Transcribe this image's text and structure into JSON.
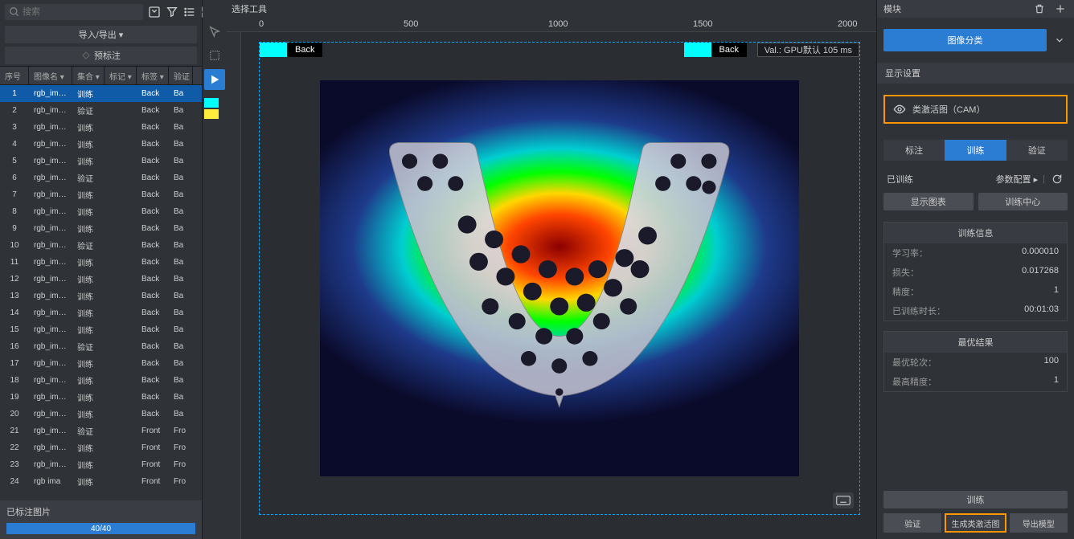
{
  "search": {
    "placeholder": "搜索"
  },
  "import_export": "导入/导出 ▾",
  "pre_annotate": "预标注",
  "table": {
    "headers": {
      "idx": "序号",
      "name": "图像名 ▾",
      "set": "集合 ▾",
      "mark": "标记 ▾",
      "tag": "标签 ▾",
      "val": "验证"
    },
    "rows": [
      {
        "idx": "1",
        "name": "rgb_ima...",
        "set": "训练",
        "tag": "Back",
        "val": "Ba"
      },
      {
        "idx": "2",
        "name": "rgb_ima...",
        "set": "验证",
        "tag": "Back",
        "val": "Ba"
      },
      {
        "idx": "3",
        "name": "rgb_ima...",
        "set": "训练",
        "tag": "Back",
        "val": "Ba"
      },
      {
        "idx": "4",
        "name": "rgb_ima...",
        "set": "训练",
        "tag": "Back",
        "val": "Ba"
      },
      {
        "idx": "5",
        "name": "rgb_ima...",
        "set": "训练",
        "tag": "Back",
        "val": "Ba"
      },
      {
        "idx": "6",
        "name": "rgb_ima...",
        "set": "验证",
        "tag": "Back",
        "val": "Ba"
      },
      {
        "idx": "7",
        "name": "rgb_ima...",
        "set": "训练",
        "tag": "Back",
        "val": "Ba"
      },
      {
        "idx": "8",
        "name": "rgb_ima...",
        "set": "训练",
        "tag": "Back",
        "val": "Ba"
      },
      {
        "idx": "9",
        "name": "rgb_ima...",
        "set": "训练",
        "tag": "Back",
        "val": "Ba"
      },
      {
        "idx": "10",
        "name": "rgb_ima...",
        "set": "验证",
        "tag": "Back",
        "val": "Ba"
      },
      {
        "idx": "11",
        "name": "rgb_ima...",
        "set": "训练",
        "tag": "Back",
        "val": "Ba"
      },
      {
        "idx": "12",
        "name": "rgb_ima...",
        "set": "训练",
        "tag": "Back",
        "val": "Ba"
      },
      {
        "idx": "13",
        "name": "rgb_ima...",
        "set": "训练",
        "tag": "Back",
        "val": "Ba"
      },
      {
        "idx": "14",
        "name": "rgb_ima...",
        "set": "训练",
        "tag": "Back",
        "val": "Ba"
      },
      {
        "idx": "15",
        "name": "rgb_ima...",
        "set": "训练",
        "tag": "Back",
        "val": "Ba"
      },
      {
        "idx": "16",
        "name": "rgb_ima...",
        "set": "验证",
        "tag": "Back",
        "val": "Ba"
      },
      {
        "idx": "17",
        "name": "rgb_ima...",
        "set": "训练",
        "tag": "Back",
        "val": "Ba"
      },
      {
        "idx": "18",
        "name": "rgb_ima...",
        "set": "训练",
        "tag": "Back",
        "val": "Ba"
      },
      {
        "idx": "19",
        "name": "rgb_ima...",
        "set": "训练",
        "tag": "Back",
        "val": "Ba"
      },
      {
        "idx": "20",
        "name": "rgb_ima...",
        "set": "训练",
        "tag": "Back",
        "val": "Ba"
      },
      {
        "idx": "21",
        "name": "rgb_ima...",
        "set": "验证",
        "tag": "Front",
        "val": "Fro"
      },
      {
        "idx": "22",
        "name": "rgb_ima...",
        "set": "训练",
        "tag": "Front",
        "val": "Fro"
      },
      {
        "idx": "23",
        "name": "rgb_ima...",
        "set": "训练",
        "tag": "Front",
        "val": "Fro"
      },
      {
        "idx": "24",
        "name": "rgb ima",
        "set": "训练",
        "tag": "Front",
        "val": "Fro"
      }
    ]
  },
  "footer": {
    "status": "已标注图片",
    "progress": "40/40"
  },
  "center": {
    "header": "选择工具",
    "ruler": {
      "r0": "0",
      "r500": "500",
      "r1000": "1000",
      "r1500": "1500",
      "r2000": "2000"
    },
    "back_label1": "Back",
    "back_label2": "Back",
    "val_label": "Val.:  GPU默认 105 ms"
  },
  "legend_colors": [
    "#00ffff",
    "#ffeb3b"
  ],
  "right": {
    "module": "模块",
    "classify_btn": "图像分类",
    "display_settings": "显示设置",
    "cam_label": "类激活图（CAM）",
    "tabs": {
      "annotate": "标注",
      "train": "训练",
      "validate": "验证"
    },
    "trained_left": "已训练",
    "trained_right": "参数配置 ▸",
    "show_chart": "显示图表",
    "train_center": "训练中心",
    "train_info": {
      "title": "训练信息",
      "lr_label": "学习率：",
      "lr": "0.000010",
      "loss_label": "损失：",
      "loss": "0.017268",
      "acc_label": "精度：",
      "acc": "1",
      "dur_label": "已训练时长：",
      "dur": "00:01:03"
    },
    "best": {
      "title": "最优结果",
      "epoch_label": "最优轮次：",
      "epoch": "100",
      "acc_label": "最高精度：",
      "acc": "1"
    },
    "train_btn": "训练",
    "bottom": {
      "validate": "验证",
      "gen_cam": "生成类激活图",
      "export": "导出模型"
    }
  }
}
